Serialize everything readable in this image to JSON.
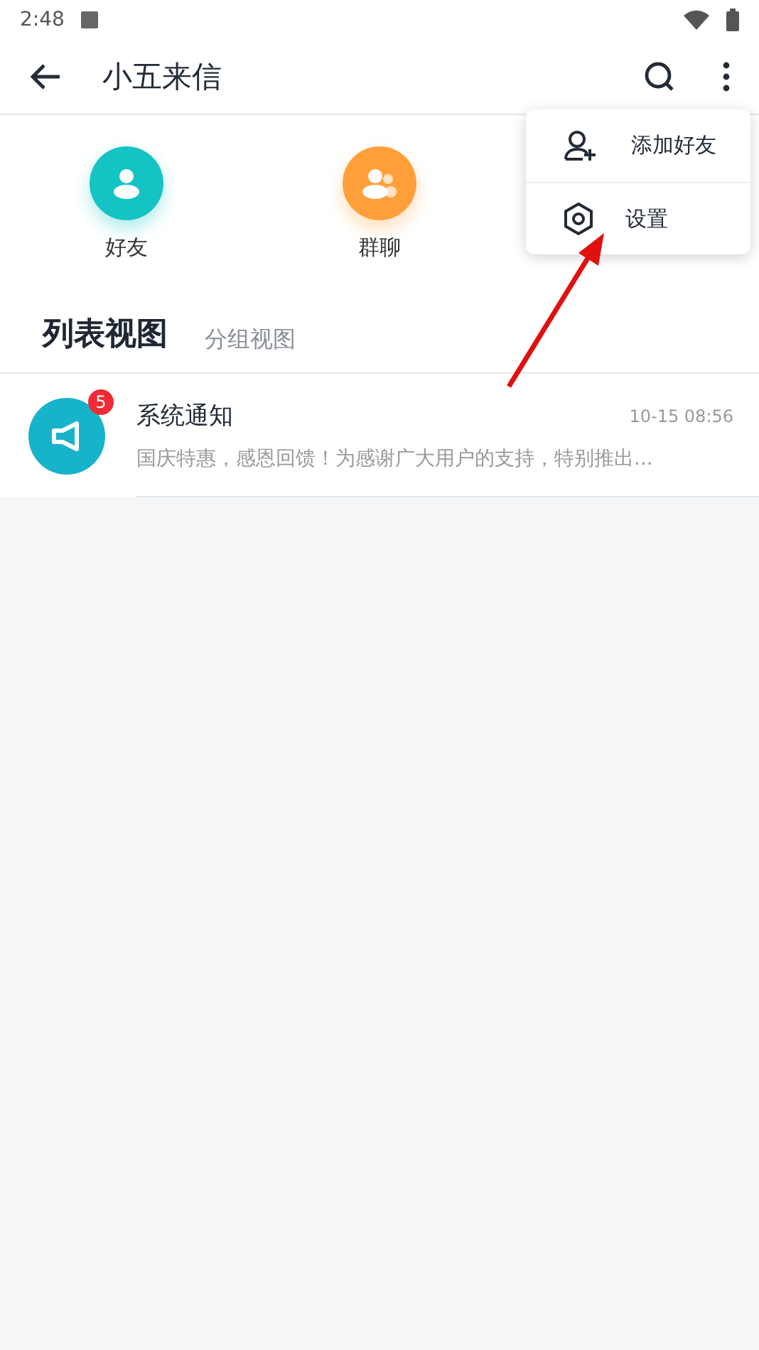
{
  "status_bar": {
    "time": "2:48"
  },
  "toolbar": {
    "title": "小五来信"
  },
  "shortcuts": [
    {
      "label": "好友",
      "kind": "friend",
      "color": "#14c4c4"
    },
    {
      "label": "群聊",
      "kind": "group",
      "color": "#ff9f3a"
    }
  ],
  "tabs": [
    {
      "label": "列表视图",
      "selected": true
    },
    {
      "label": "分组视图",
      "selected": false
    }
  ],
  "conversations": [
    {
      "name": "系统通知",
      "time": "10-15 08:56",
      "preview": "国庆特惠，感恩回馈！为感谢广大用户的支持，特别推出...",
      "badge": "5"
    }
  ],
  "menu": {
    "items": [
      {
        "label": "添加好友",
        "kind": "add-friend"
      },
      {
        "label": "设置",
        "kind": "settings"
      }
    ]
  }
}
